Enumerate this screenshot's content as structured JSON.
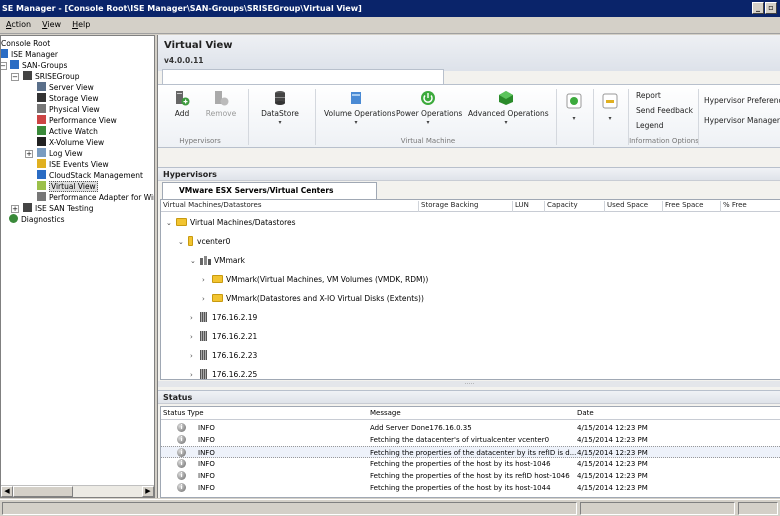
{
  "window": {
    "title": "SE Manager - [Console Root\\ISE Manager\\SAN-Groups\\SRISEGroup\\Virtual View]",
    "min_glyph": "_",
    "restore_glyph": "▫"
  },
  "menu": [
    "Action",
    "View",
    "Help"
  ],
  "tree": {
    "items": [
      {
        "label": "Console Root",
        "name": "tree-console-root"
      },
      {
        "label": "ISE Manager",
        "name": "tree-ise-manager"
      },
      {
        "label": "SAN-Groups",
        "name": "tree-san-groups"
      },
      {
        "label": "SRISEGroup",
        "name": "tree-srisegroup"
      },
      {
        "label": "Server View",
        "name": "tree-server-view"
      },
      {
        "label": "Storage View",
        "name": "tree-storage-view"
      },
      {
        "label": "Physical View",
        "name": "tree-physical-view"
      },
      {
        "label": "Performance View",
        "name": "tree-performance-view"
      },
      {
        "label": "Active Watch",
        "name": "tree-active-watch"
      },
      {
        "label": "X-Volume View",
        "name": "tree-x-volume-view"
      },
      {
        "label": "Log View",
        "name": "tree-log-view"
      },
      {
        "label": "ISE Events View",
        "name": "tree-ise-events-view"
      },
      {
        "label": "CloudStack Management",
        "name": "tree-cloudstack-management"
      },
      {
        "label": "Virtual View",
        "name": "tree-virtual-view"
      },
      {
        "label": "Performance Adapter for Windows",
        "name": "tree-performance-adapter"
      },
      {
        "label": "ISE SAN Testing",
        "name": "tree-ise-san-testing"
      },
      {
        "label": "Diagnostics",
        "name": "tree-diagnostics"
      }
    ],
    "expand_minus": "−",
    "expand_plus": "+",
    "arrow_left": "◀",
    "arrow_right": "▶"
  },
  "main": {
    "title": "Virtual View",
    "version": "v4.0.0.11"
  },
  "ribbon": {
    "add": "Add",
    "remove": "Remove",
    "datastore": "DataStore",
    "volume_ops": "Volume Operations",
    "power_ops": "Power Operations",
    "advanced_ops": "Advanced Operations",
    "report": "Report",
    "send_feedback": "Send Feedback",
    "legend": "Legend",
    "hv_preferences": "Hypervisor Preferences",
    "hv_manager": "Hypervisor Manager",
    "group_hypervisors": "Hypervisors",
    "group_virtual_machine": "Virtual Machine",
    "group_info": "Information Options",
    "dropdown_glyph": "▾"
  },
  "hypervisors": {
    "panel_title": "Hypervisors",
    "tab": "VMware ESX Servers/Virtual Centers",
    "columns": [
      "Virtual Machines/Datastores",
      "Storage Backing",
      "LUN",
      "Capacity",
      "Used Space",
      "Free Space",
      "% Free"
    ],
    "rows": [
      {
        "label": "Virtual Machines/Datastores",
        "chev": "⌄"
      },
      {
        "label": "vcenter0",
        "chev": "⌄"
      },
      {
        "label": "VMmark",
        "chev": "⌄"
      },
      {
        "label": "VMmark(Virtual Machines, VM Volumes (VMDK, RDM))",
        "chev": "›"
      },
      {
        "label": "VMmark(Datastores and X-IO Virtual Disks (Extents))",
        "chev": "›"
      },
      {
        "label": "176.16.2.19",
        "chev": "›"
      },
      {
        "label": "176.16.2.21",
        "chev": "›"
      },
      {
        "label": "176.16.2.23",
        "chev": "›"
      },
      {
        "label": "176.16.2.25",
        "chev": "›"
      }
    ],
    "splitter_glyph": "....."
  },
  "status": {
    "panel_title": "Status",
    "columns": [
      "Status Type",
      "Message",
      "Date"
    ],
    "rows": [
      {
        "type": "INFO",
        "message": "Add Server Done176.16.0.35",
        "date": "4/15/2014 12:23 PM"
      },
      {
        "type": "INFO",
        "message": "Fetching the datacenter's of virtualcenter vcenter0",
        "date": "4/15/2014 12:23 PM"
      },
      {
        "type": "INFO",
        "message": "Fetching the properties of the datacenter by its refID is d...",
        "date": "4/15/2014 12:23 PM"
      },
      {
        "type": "INFO",
        "message": "Fetching the properties of the host by its host-1046",
        "date": "4/15/2014 12:23 PM"
      },
      {
        "type": "INFO",
        "message": "Fetching the properties of the host by its refID host-1046",
        "date": "4/15/2014 12:23 PM"
      },
      {
        "type": "INFO",
        "message": "Fetching the properties of the host by its host-1044",
        "date": "4/15/2014 12:23 PM"
      }
    ]
  }
}
